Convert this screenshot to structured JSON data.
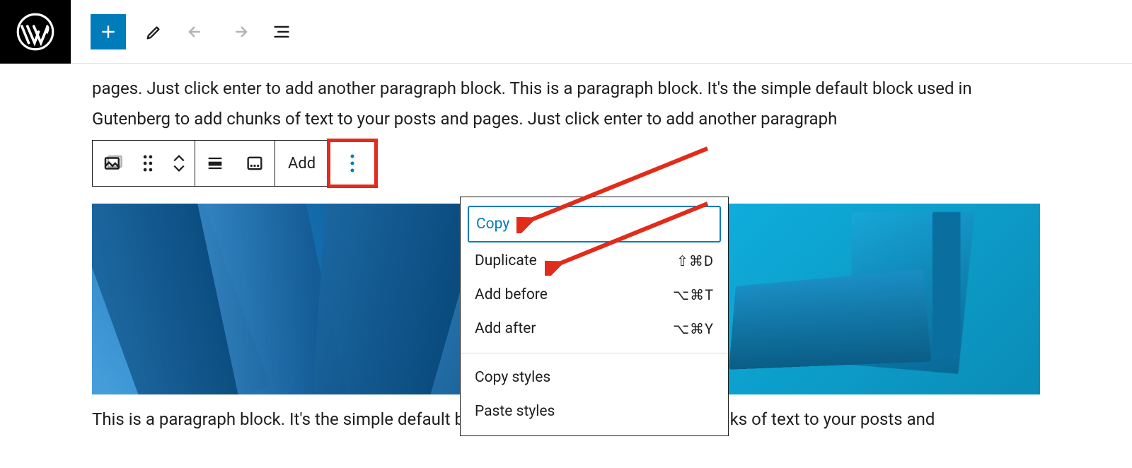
{
  "topbar": {
    "add_tooltip": "Add block",
    "edit_tooltip": "Tools",
    "undo_tooltip": "Undo",
    "redo_tooltip": "Redo",
    "outline_tooltip": "Document overview"
  },
  "paragraph_top": "pages. Just click enter to add another paragraph block. This is a paragraph block. It's the simple default block used in Gutenberg to add chunks of text to your posts and pages. Just click enter to add another paragraph",
  "paragraph_bottom": "This is a paragraph block. It's the simple default block used in Gutenberg to add chunks of text to your posts and",
  "toolbar": {
    "add_label": "Add",
    "block_type_tooltip": "Gallery",
    "drag_tooltip": "Drag",
    "move_tooltip": "Move up/down",
    "align_tooltip": "Align",
    "caption_tooltip": "Caption",
    "options_tooltip": "Options"
  },
  "menu": {
    "section1": [
      {
        "label": "Copy",
        "shortcut": "",
        "highlighted": true
      },
      {
        "label": "Duplicate",
        "shortcut": "⇧⌘D"
      },
      {
        "label": "Add before",
        "shortcut": "⌥⌘T"
      },
      {
        "label": "Add after",
        "shortcut": "⌥⌘Y"
      }
    ],
    "section2": [
      {
        "label": "Copy styles",
        "shortcut": ""
      },
      {
        "label": "Paste styles",
        "shortcut": ""
      }
    ]
  },
  "colors": {
    "accent": "#007cba",
    "highlight_border": "#e22b1a"
  }
}
